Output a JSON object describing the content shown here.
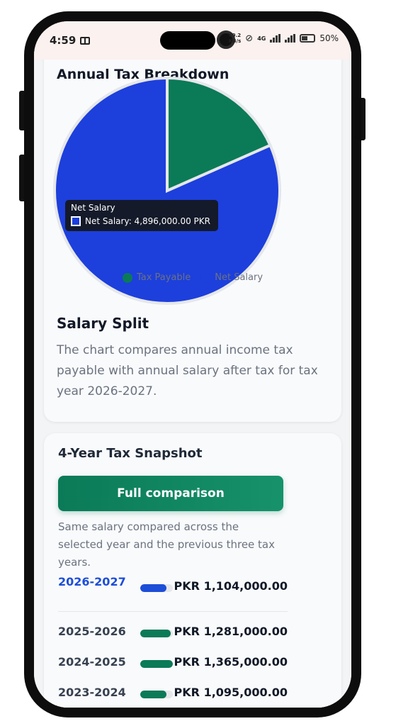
{
  "status": {
    "time": "4:59",
    "net_speed_top": "49.2",
    "net_speed_bottom": "KB/s",
    "network": "4G",
    "battery": "50%"
  },
  "card1": {
    "title": "Annual Tax Breakdown",
    "tooltip_title": "Net Salary",
    "tooltip_value": "Net Salary: 4,896,000.00 PKR",
    "legend": [
      {
        "label": "Tax Payable",
        "color": "#0b7a57"
      },
      {
        "label": "Net Salary",
        "color": "#1d3fdc"
      }
    ],
    "section_title": "Salary Split",
    "section_body": "The chart compares annual income tax payable with annual salary after tax for tax year 2026-2027."
  },
  "chart_data": {
    "type": "pie",
    "series": [
      {
        "name": "Tax Payable",
        "value": 1104000,
        "color": "#0b7a57"
      },
      {
        "name": "Net Salary",
        "value": 4896000,
        "color": "#1d3fdc"
      }
    ]
  },
  "card2": {
    "title": "4-Year Tax Snapshot",
    "button_label": "Full comparison",
    "description": "Same salary compared across the selected year and the previous three tax years.",
    "rows": [
      {
        "year": "2026-2027",
        "amount": "PKR 1,104,000.00",
        "fraction": 0.81,
        "color": "#1d4ed8",
        "active": true
      },
      {
        "year": "2025-2026",
        "amount": "PKR 1,281,000.00",
        "fraction": 0.94,
        "color": "#0b7a57",
        "active": false
      },
      {
        "year": "2024-2025",
        "amount": "PKR 1,365,000.00",
        "fraction": 1.0,
        "color": "#0b7a57",
        "active": false
      },
      {
        "year": "2023-2024",
        "amount": "PKR 1,095,000.00",
        "fraction": 0.8,
        "color": "#0b7a57",
        "active": false
      }
    ]
  }
}
